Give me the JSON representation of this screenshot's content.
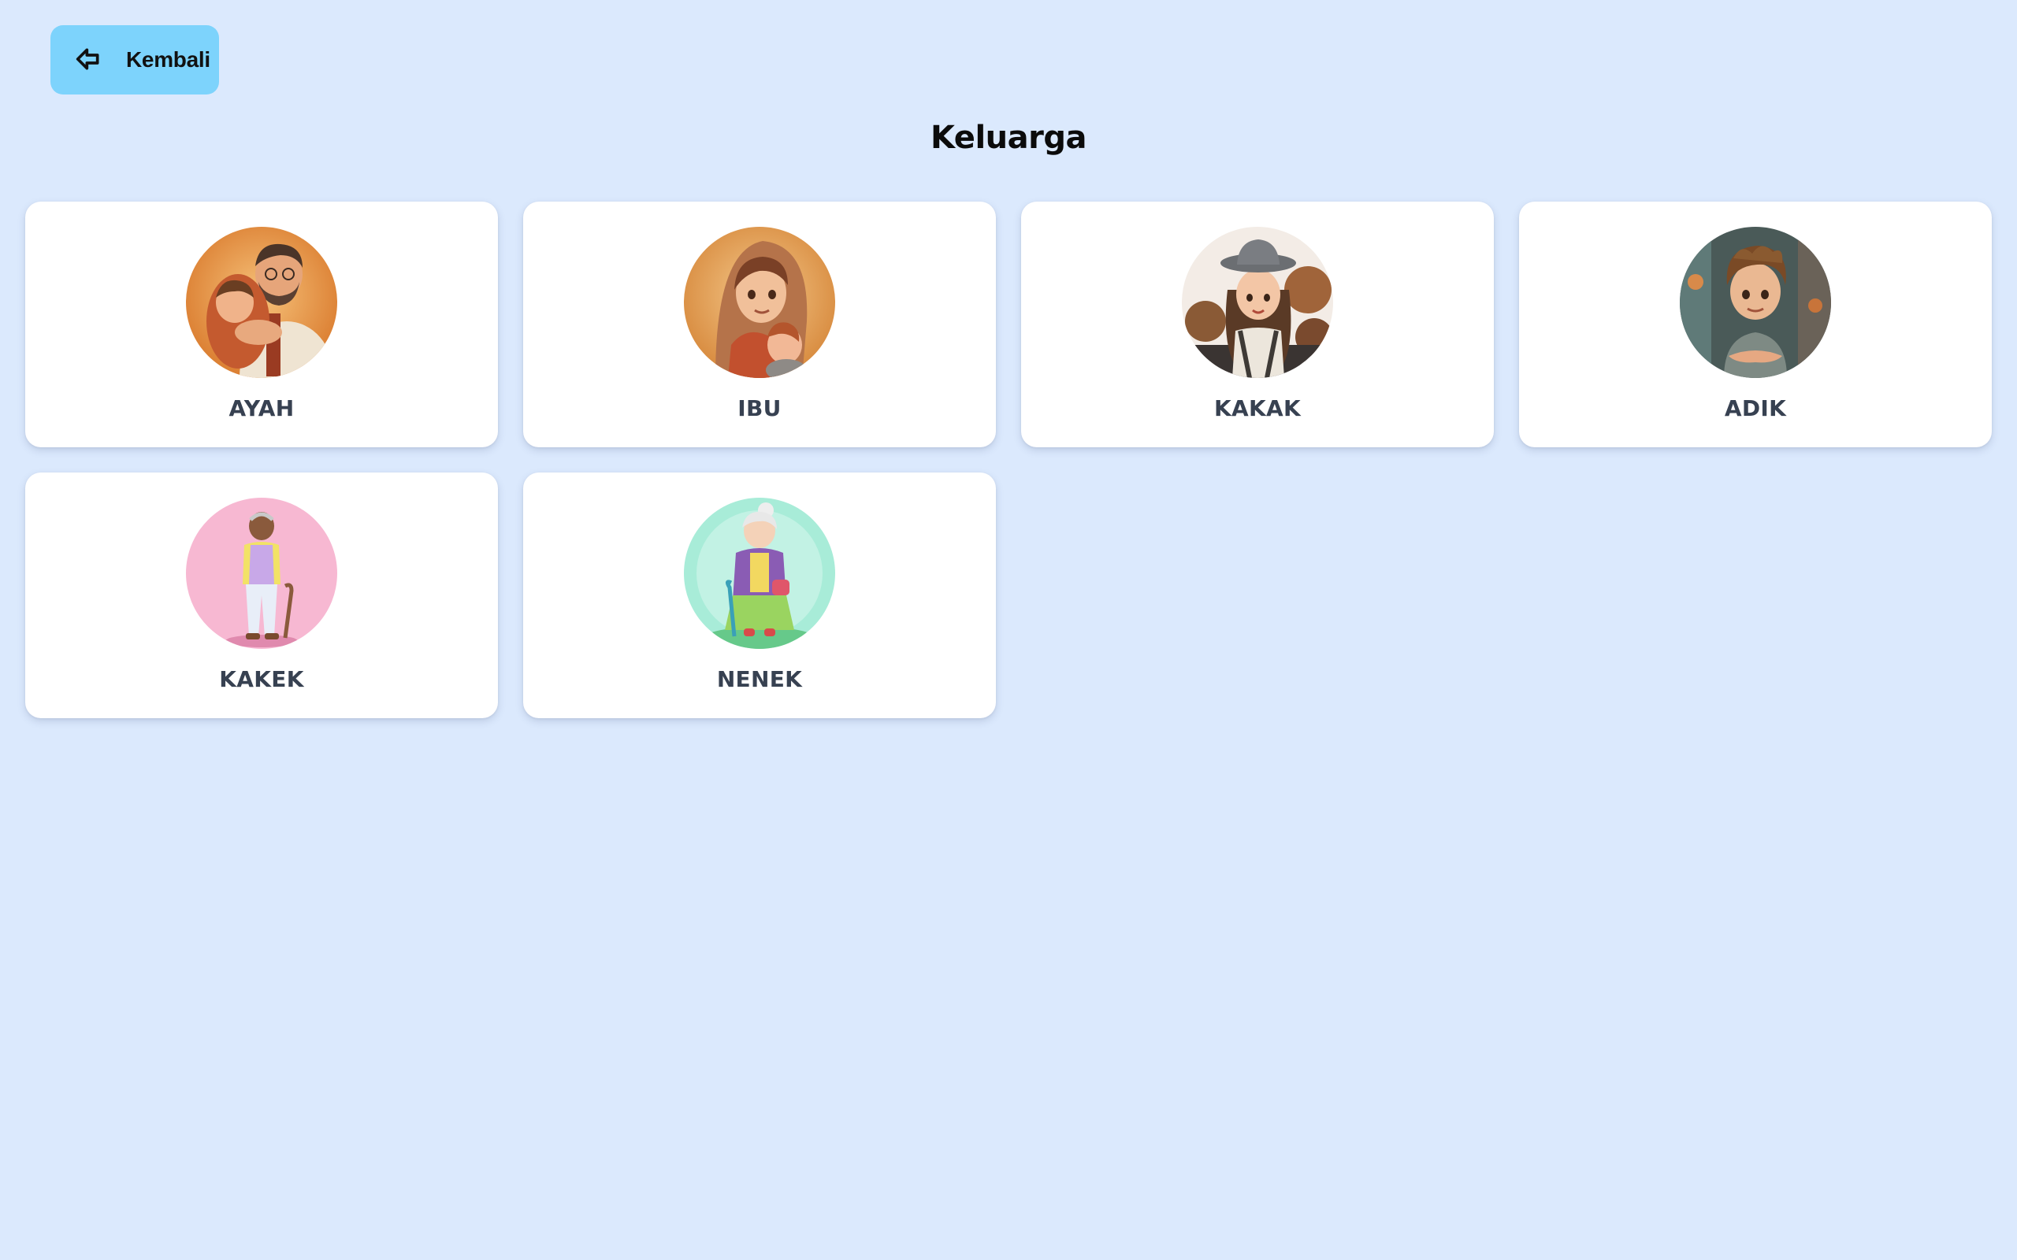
{
  "header": {
    "back_label": "Kembali",
    "back_icon": "arrow-left-icon",
    "title": "Keluarga"
  },
  "cards": [
    {
      "label": "AYAH",
      "illustration": "father-hugging-child-illustration"
    },
    {
      "label": "IBU",
      "illustration": "mother-holding-baby-illustration"
    },
    {
      "label": "KAKAK",
      "illustration": "older-sister-illustration"
    },
    {
      "label": "ADIK",
      "illustration": "younger-brother-illustration"
    },
    {
      "label": "KAKEK",
      "illustration": "grandfather-with-cane-illustration"
    },
    {
      "label": "NENEK",
      "illustration": "grandmother-with-cane-illustration"
    }
  ],
  "colors": {
    "page_background": "#dbe9fd",
    "back_button": "#7dd3fc",
    "card_background": "#ffffff",
    "card_label": "#374151"
  }
}
